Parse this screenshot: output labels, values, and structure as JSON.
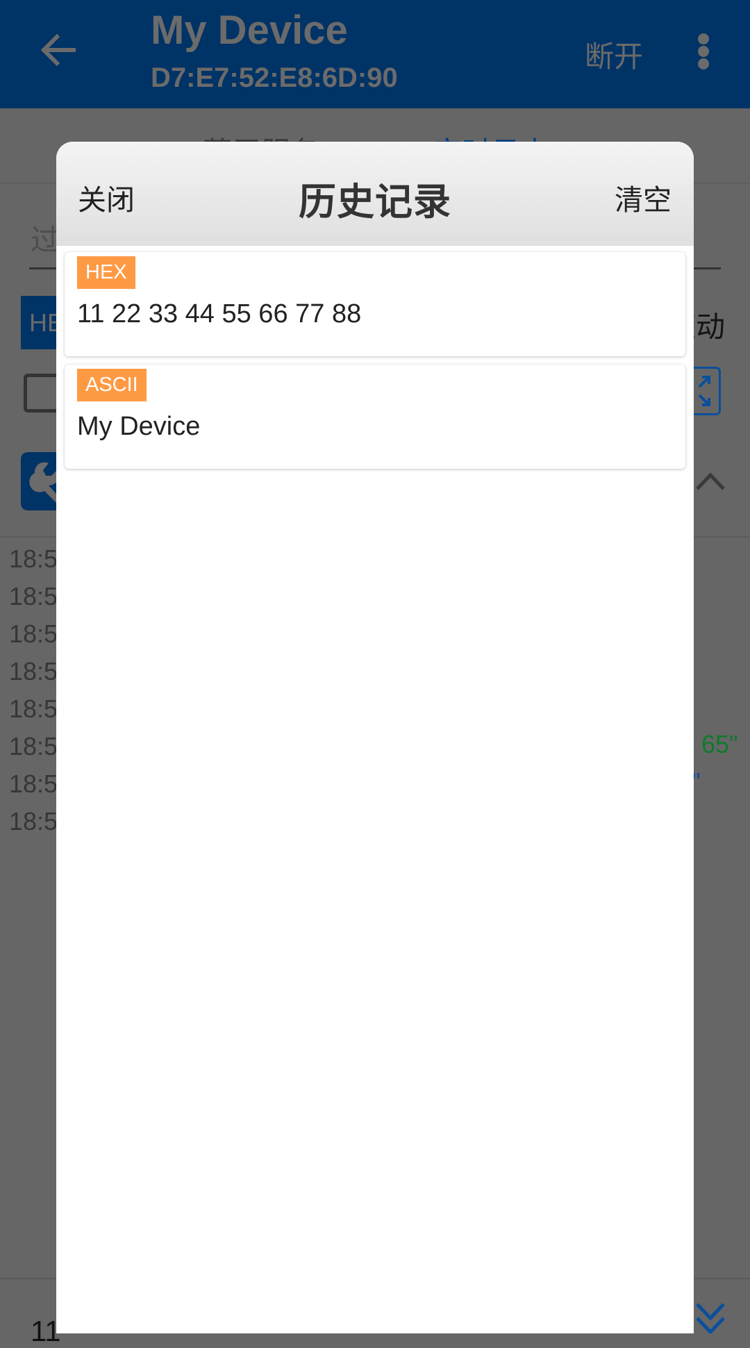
{
  "app_bar": {
    "title": "My Device",
    "subtitle": "D7:E7:52:E8:6D:90",
    "disconnect_label": "断开",
    "back_icon": "arrow-left-icon",
    "more_icon": "more-vert-icon"
  },
  "tabs": [
    {
      "label": "蓝牙服务",
      "selected": false
    },
    {
      "label": "实时日志",
      "selected": true
    }
  ],
  "log_panel": {
    "filter_placeholder": "过",
    "hex_toggle_label": "HE",
    "autoscroll_label": "滚动",
    "log_rows": [
      "18:5",
      "18:5",
      "18:5",
      "18:5",
      "18:5",
      "18:5",
      "18:5",
      "18:5"
    ],
    "partial_text_green": "65\"",
    "partial_text_blue": "\"",
    "input_value": "11",
    "icons": {
      "checkbox": "checkbox-icon",
      "expand": "expand-icon",
      "tool": "wrench-icon",
      "collapse": "chevron-up-icon",
      "scroll_bottom": "double-chevron-down-icon"
    }
  },
  "dialog": {
    "title": "历史记录",
    "close_label": "关闭",
    "clear_label": "清空",
    "items": [
      {
        "type": "HEX",
        "value": "11 22 33 44 55 66 77 88"
      },
      {
        "type": "ASCII",
        "value": "My Device"
      }
    ]
  },
  "colors": {
    "brand_blue": "#003366",
    "badge_orange": "#ff9a44",
    "overlay": "#666666"
  }
}
